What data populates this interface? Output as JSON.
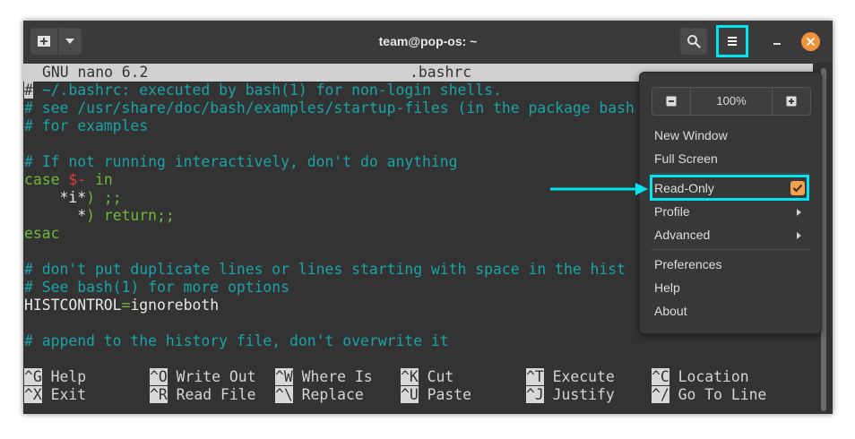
{
  "window": {
    "title": "team@pop-os: ~"
  },
  "nano": {
    "version_label": "GNU nano 6.2",
    "filename": ".bashrc"
  },
  "code": {
    "l1": "~/.bashrc: executed by bash(1) for non-login shells.",
    "l1_lead": "#",
    "l2": "# see /usr/share/doc/bash/examples/startup-files (in the package bash",
    "l3": "# for examples",
    "l5": "# If not running interactively, don't do anything",
    "l6_kw": "case",
    "l6_var": "$-",
    "l6_in": "in",
    "l7_pre": "*i*",
    "l7_post": ") ;;",
    "l8_pre": "*",
    "l8_post": ") return;;",
    "l9": "esac",
    "l11": "# don't put duplicate lines or lines starting with space in the hist",
    "l12": "# See bash(1) for more options",
    "l13_name": "HISTCONTROL",
    "l13_eq": "=",
    "l13_val": "ignoreboth",
    "l15": "# append to the history file, don't overwrite it"
  },
  "shortcuts": [
    {
      "key": "^G",
      "label": "Help"
    },
    {
      "key": "^O",
      "label": "Write Out"
    },
    {
      "key": "^W",
      "label": "Where Is"
    },
    {
      "key": "^K",
      "label": "Cut"
    },
    {
      "key": "^T",
      "label": "Execute"
    },
    {
      "key": "^C",
      "label": "Location"
    },
    {
      "key": "^X",
      "label": "Exit"
    },
    {
      "key": "^R",
      "label": "Read File"
    },
    {
      "key": "^\\",
      "label": "Replace"
    },
    {
      "key": "^U",
      "label": "Paste"
    },
    {
      "key": "^J",
      "label": "Justify"
    },
    {
      "key": "^/",
      "label": "Go To Line"
    }
  ],
  "menu": {
    "zoom_level": "100%",
    "items": {
      "new_window": "New Window",
      "full_screen": "Full Screen",
      "read_only": "Read-Only",
      "profile": "Profile",
      "advanced": "Advanced",
      "preferences": "Preferences",
      "help": "Help",
      "about": "About"
    },
    "read_only_checked": true
  },
  "colors": {
    "highlight": "#00e5f0",
    "close_button": "#f0923b",
    "checkbox": "#f0a050",
    "comment": "#1aa3a8",
    "keyword": "#6eb83a"
  },
  "icons": {
    "new_tab": "new-tab-icon",
    "tab_menu": "chevron-down-icon",
    "search": "search-icon",
    "menu": "hamburger-menu-icon",
    "minimize": "minimize-icon",
    "close": "close-icon"
  }
}
